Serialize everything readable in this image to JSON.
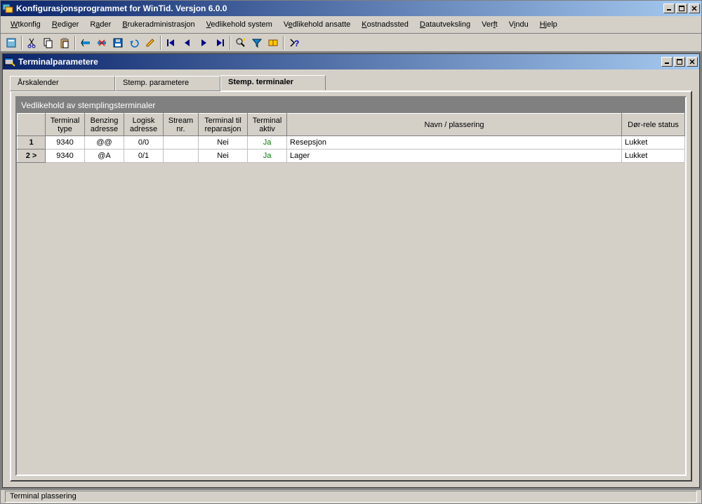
{
  "window": {
    "title": "Konfigurasjonsprogrammet for WinTid. Versjon 6.0.0"
  },
  "menubar": [
    "Wtkonfig",
    "Rediger",
    "Rader",
    "Brukeradministrasjon",
    "Vedlikehold system",
    "Vedlikehold ansatte",
    "Kostnadssted",
    "Datautveksling",
    "Verft",
    "Vindu",
    "Hjelp"
  ],
  "inner": {
    "title": "Terminalparametere"
  },
  "tabs": {
    "t1": "Årskalender",
    "t2": "Stemp. parametere",
    "t3": "Stemp. terminaler"
  },
  "panel": {
    "title": "Vedlikehold av stemplingsterminaler"
  },
  "headers": {
    "h0": "",
    "h1": "Terminal type",
    "h2": "Benzing adresse",
    "h3": "Logisk adresse",
    "h4": "Stream nr.",
    "h5": "Terminal til reparasjon",
    "h6": "Terminal aktiv",
    "h7": "Navn / plassering",
    "h8": "Dør-rele status"
  },
  "rows": [
    {
      "n": "1",
      "type": "9340",
      "benz": "@@",
      "log": "0/0",
      "stream": "",
      "rep": "Nei",
      "aktiv": "Ja",
      "navn": "Resepsjon",
      "dor": "Lukket"
    },
    {
      "n": "2 >",
      "type": "9340",
      "benz": "@A",
      "log": "0/1",
      "stream": "",
      "rep": "Nei",
      "aktiv": "Ja",
      "navn": "Lager",
      "dor": "Lukket"
    }
  ],
  "status": "Terminal plassering"
}
